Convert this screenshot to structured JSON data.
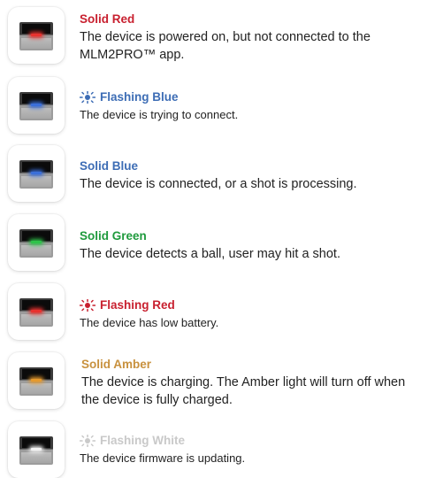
{
  "statuses": [
    {
      "title": "Solid Red",
      "description": "The device is powered on, but not connected to the MLM2PRO™ app.",
      "title_color": "#c8202f",
      "led_color": "#e8322f",
      "flashing": false
    },
    {
      "title": "Flashing Blue",
      "description": "The device is trying to connect.",
      "title_color": "#3d6db5",
      "led_color": "#3b6fd9",
      "flashing": true,
      "icon": "flashing-light-icon"
    },
    {
      "title": "Solid Blue",
      "description": "The device is connected, or a shot is processing.",
      "title_color": "#3d6db5",
      "led_color": "#3b6fd9",
      "flashing": false
    },
    {
      "title": "Solid Green",
      "description": "The device detects a ball, user may hit a shot.",
      "title_color": "#1f9a3d",
      "led_color": "#2fc24a",
      "flashing": false
    },
    {
      "title": "Flashing Red",
      "description": "The device has low battery.",
      "title_color": "#c8202f",
      "led_color": "#e8322f",
      "flashing": true,
      "icon": "flashing-light-icon"
    },
    {
      "title": "Solid Amber",
      "description": "The device is charging. The Amber light will turn off when the device is fully charged.",
      "title_color": "#c8913e",
      "led_color": "#e69a2e",
      "flashing": false
    },
    {
      "title": "Flashing White",
      "description": "The device firmware is updating.",
      "title_color": "#c9c9c9",
      "led_color": "#f2f2f2",
      "flashing": true,
      "icon": "flashing-light-icon"
    }
  ]
}
